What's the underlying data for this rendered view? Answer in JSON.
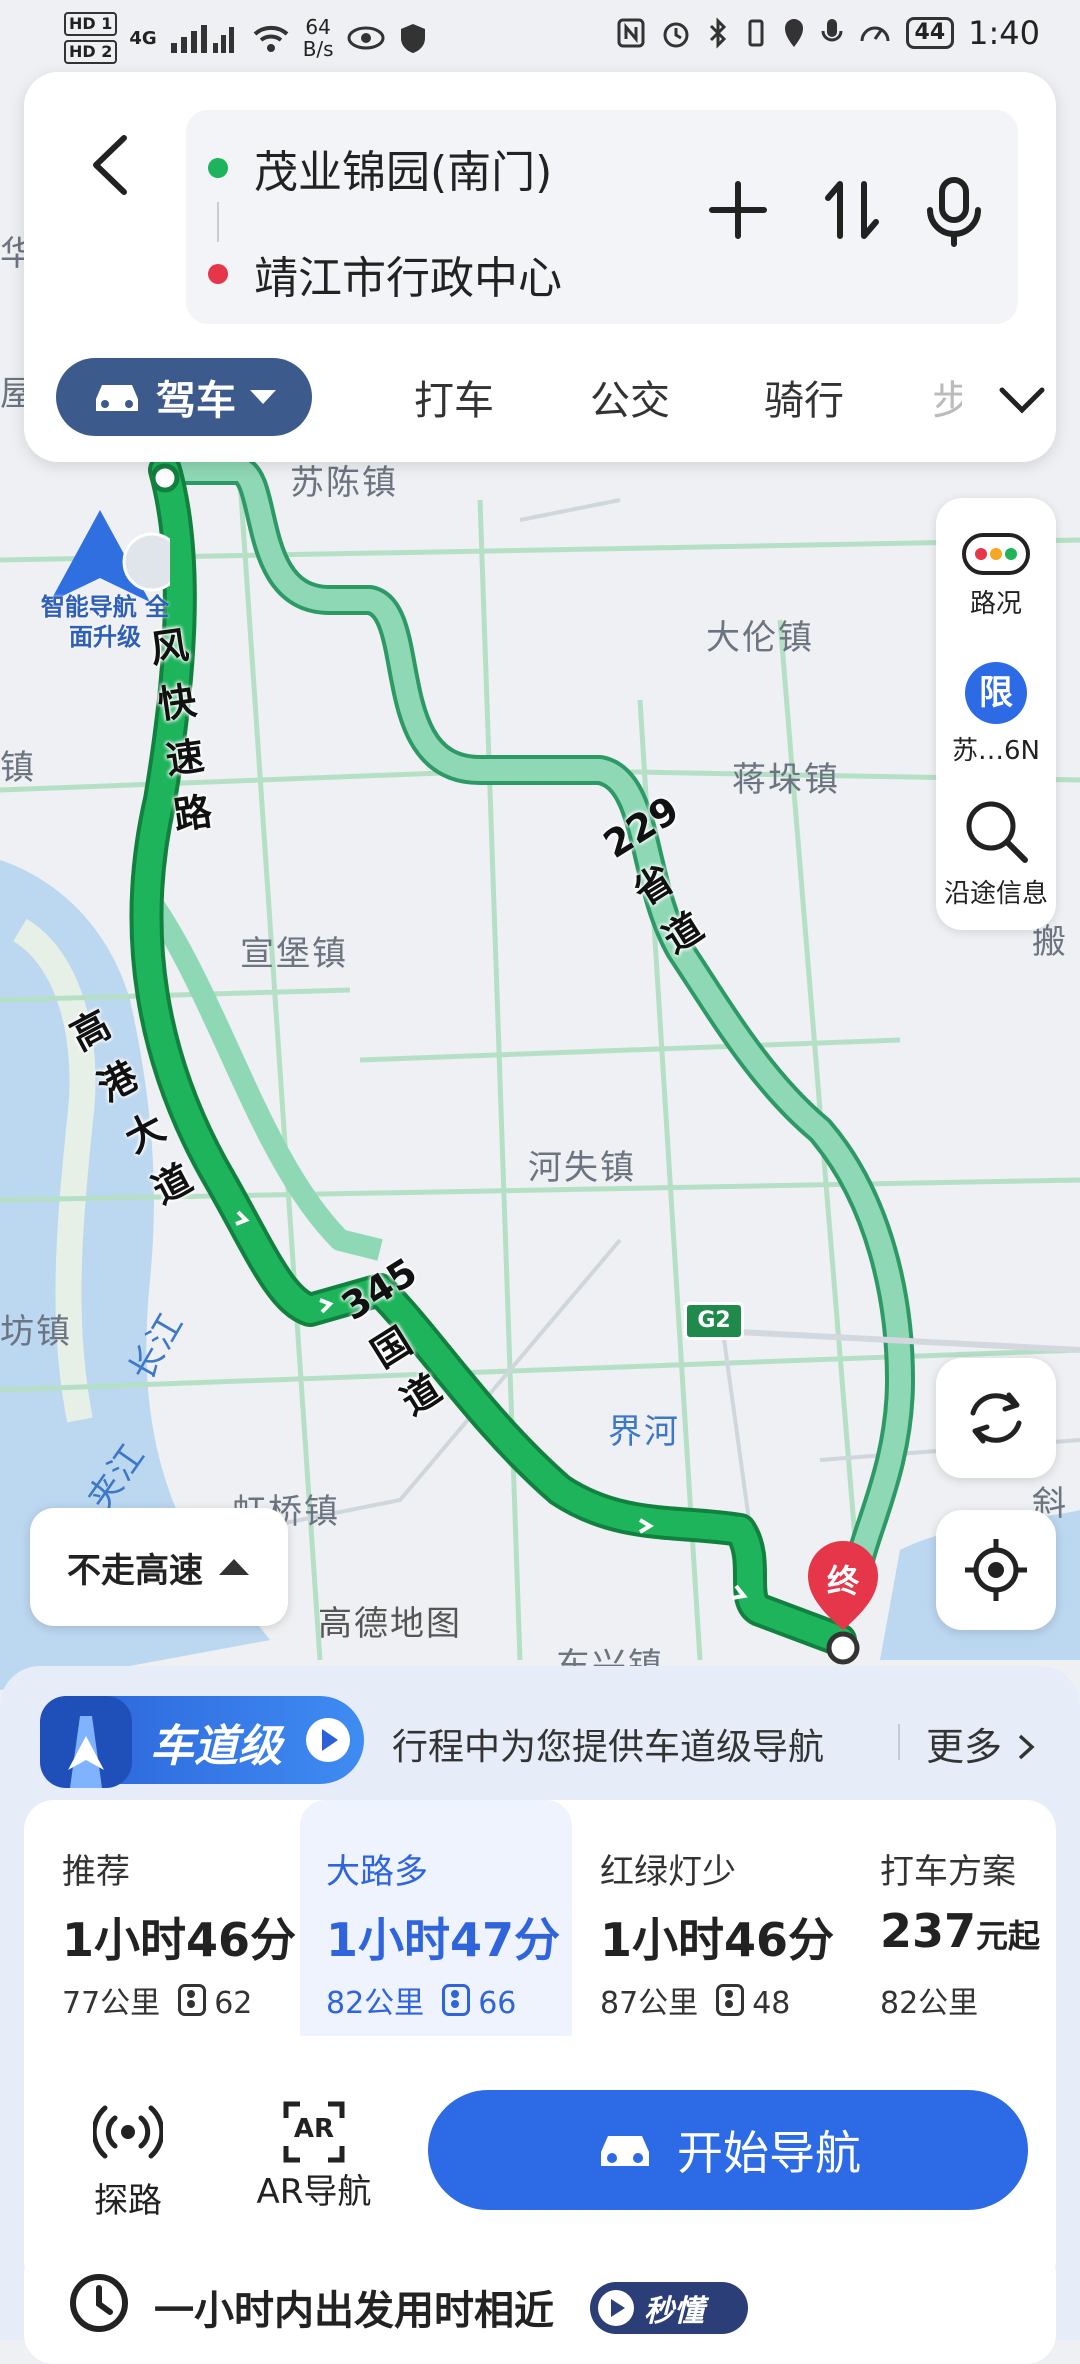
{
  "status_bar": {
    "sim1": "HD 1",
    "sim2": "HD 2",
    "network": "4G",
    "speed_value": "64",
    "speed_unit": "B/s",
    "battery": "44",
    "time": "1:40"
  },
  "route": {
    "origin": "茂业锦园(南门)",
    "destination": "靖江市行政中心"
  },
  "mode_tabs": {
    "active": "驾车",
    "items": [
      "打车",
      "公交",
      "骑行",
      "步"
    ]
  },
  "map": {
    "places": [
      "苏陈镇",
      "大伦镇",
      "蒋垛镇",
      "宣堡镇",
      "河失镇",
      "虹桥镇",
      "界河",
      "长江",
      "夹江",
      "坊镇",
      "镇",
      "斜",
      "搬",
      "华",
      "屋",
      "高德地图",
      "东兴镇"
    ],
    "roads": {
      "road_a": "风快速路",
      "road_b": "高港大道",
      "road_c": "345国道",
      "road_d": "229省道"
    },
    "highway_badge": "G2",
    "promo": "智能导航 全面升级",
    "end_marker": "终"
  },
  "right_tools": {
    "traffic": "路况",
    "limit_badge": "限",
    "limit_text": "苏…6N",
    "along_route": "沿途信息"
  },
  "avoid_highway": "不走高速",
  "lane_banner": {
    "title": "车道级",
    "desc": "行程中为您提供车道级导航",
    "more": "更多"
  },
  "route_options": [
    {
      "name": "推荐",
      "time": "1小时46分",
      "distance": "77公里",
      "lights": "62"
    },
    {
      "name": "大路多",
      "time": "1小时47分",
      "distance": "82公里",
      "lights": "66"
    },
    {
      "name": "红绿灯少",
      "time": "1小时46分",
      "distance": "87公里",
      "lights": "48"
    },
    {
      "name": "打车方案",
      "price": "237",
      "price_unit": "元起",
      "distance": "82公里"
    }
  ],
  "actions": {
    "explore": "探路",
    "ar_icon_text": "AR",
    "ar_nav": "AR导航",
    "start": "开始导航"
  },
  "depart_tip": {
    "text": "一小时内出发用时相近",
    "badge": "秒懂"
  },
  "colors": {
    "route_main": "#1eb45b",
    "route_alt": "#8fd8b6",
    "accent_blue": "#2d6be6",
    "mode_tab_active": "#3d5a8d"
  }
}
